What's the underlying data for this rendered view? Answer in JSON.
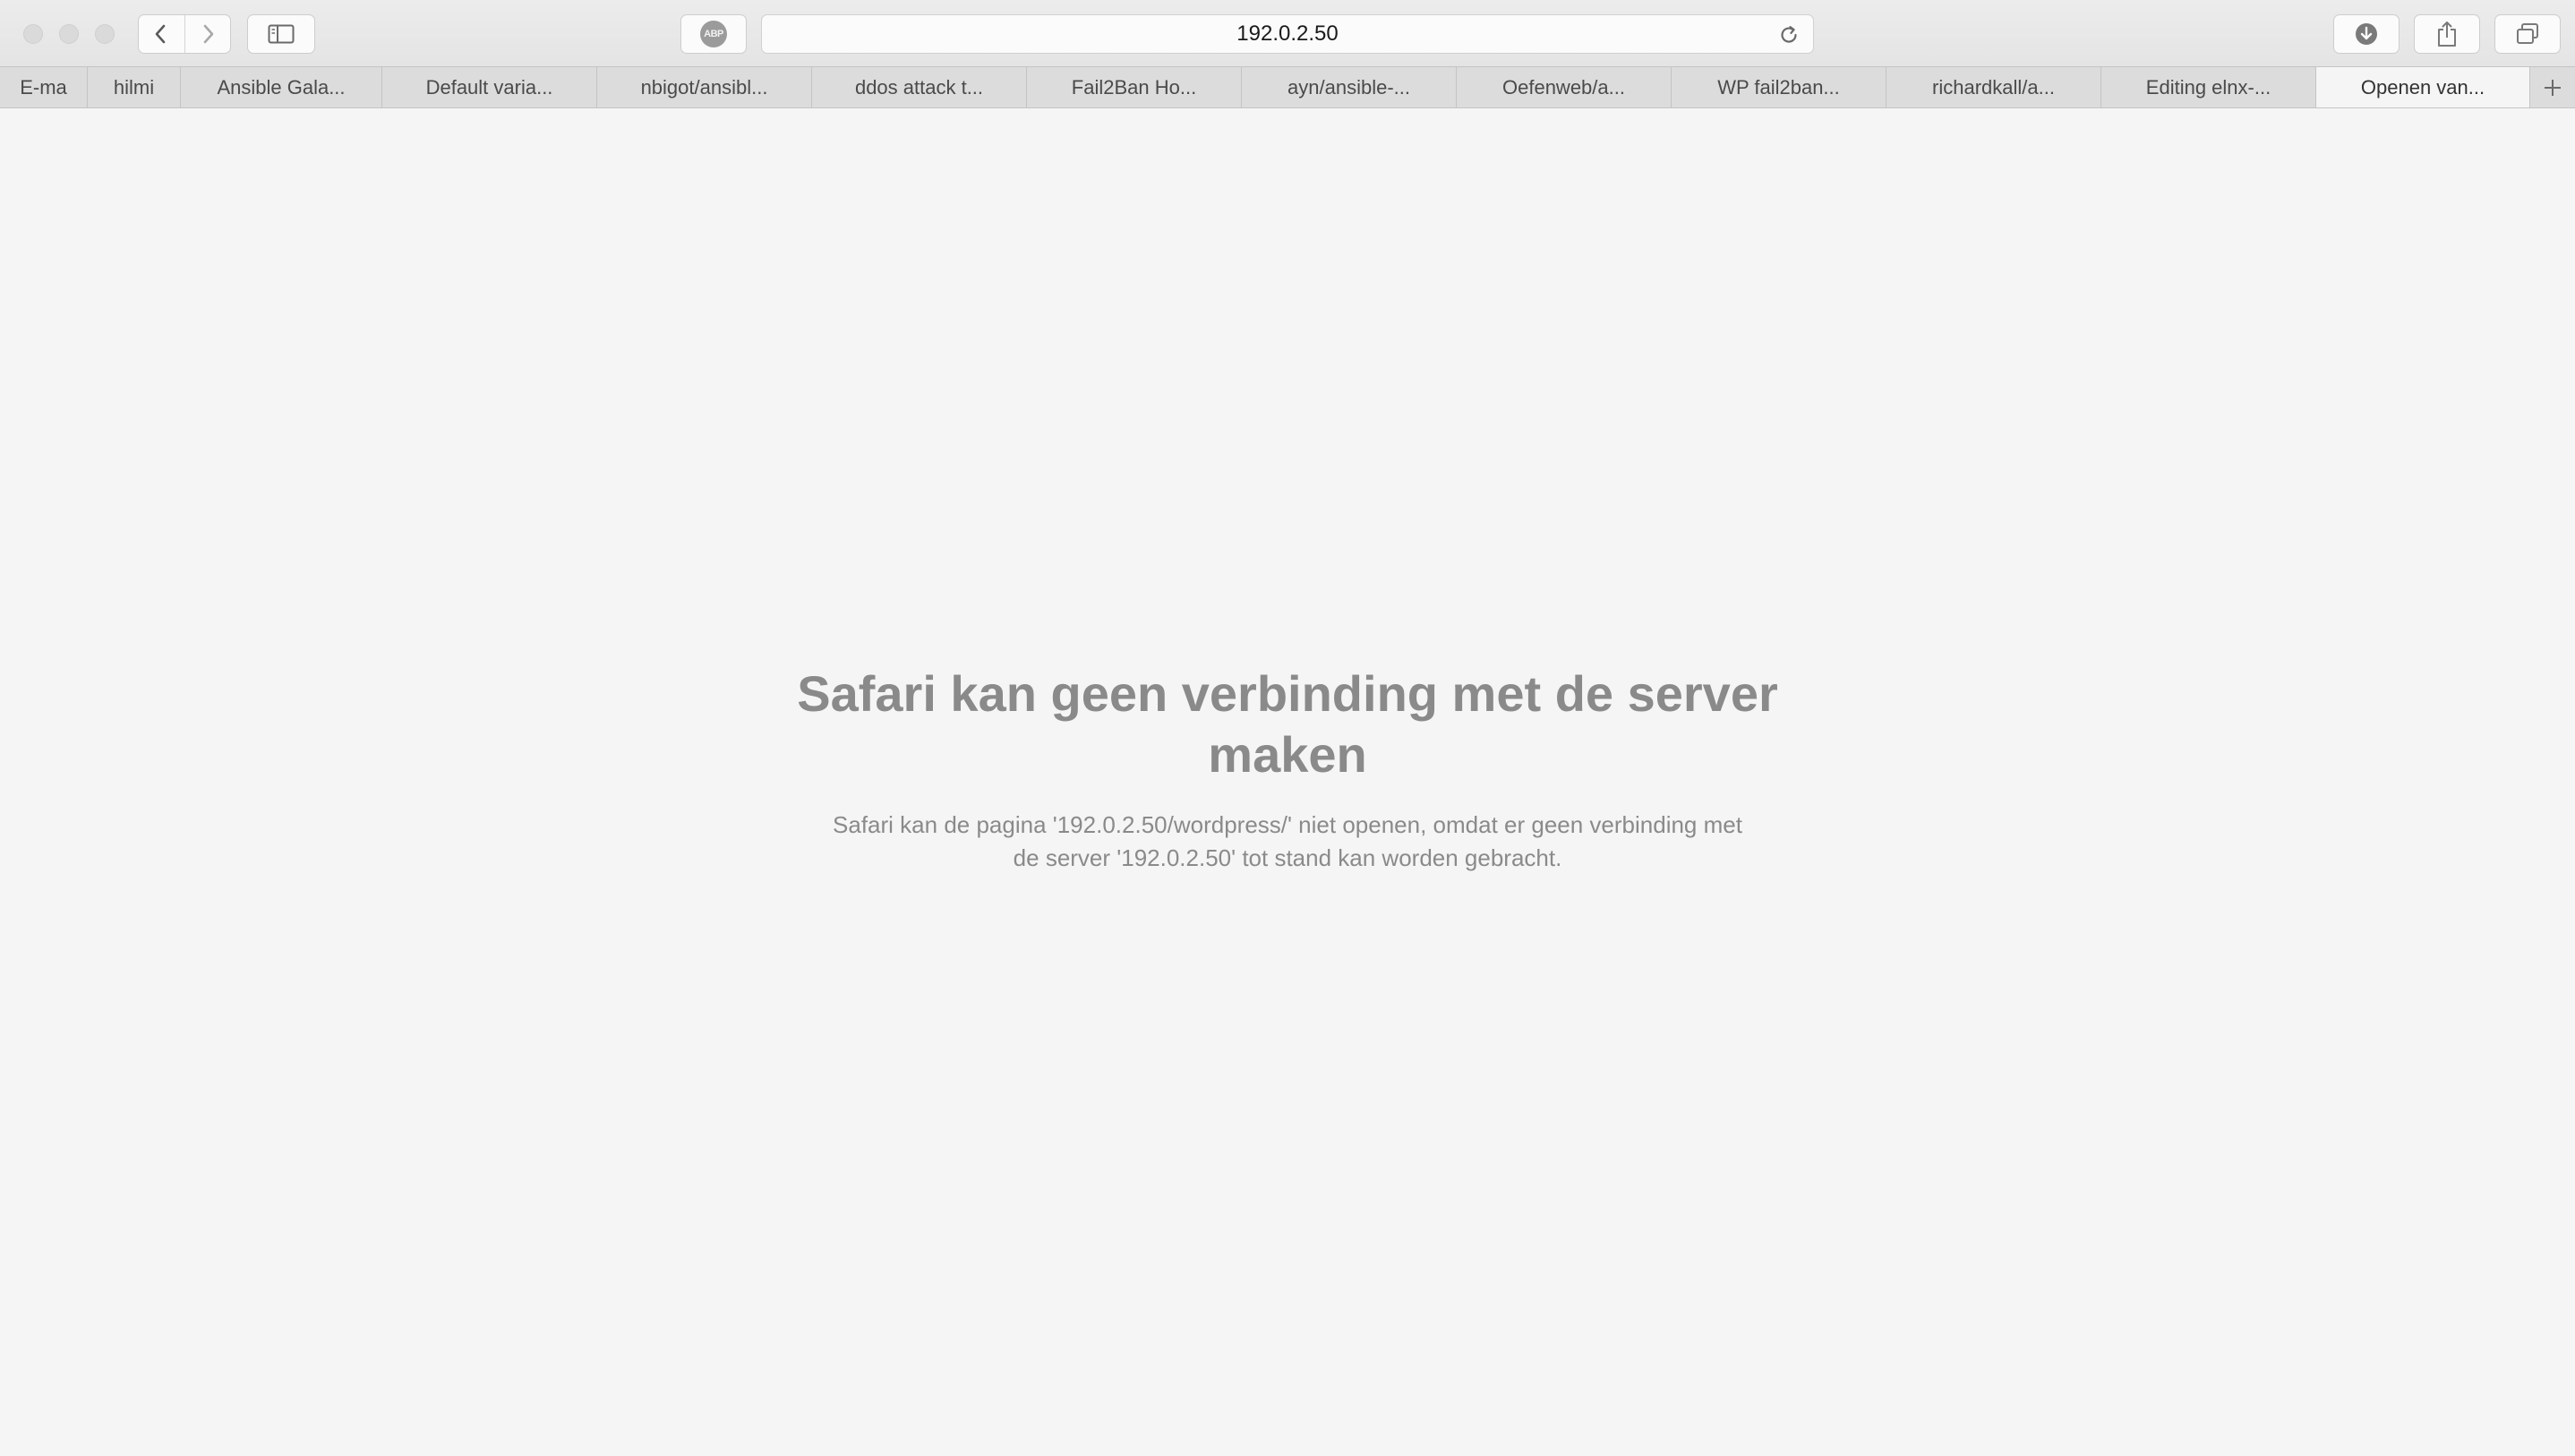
{
  "browser": {
    "address": "192.0.2.50",
    "abp_label": "ABP"
  },
  "tabs": [
    {
      "label": "E-ma"
    },
    {
      "label": "hilmi"
    },
    {
      "label": "Ansible Gala..."
    },
    {
      "label": "Default varia..."
    },
    {
      "label": "nbigot/ansibl..."
    },
    {
      "label": "ddos attack t..."
    },
    {
      "label": "Fail2Ban Ho..."
    },
    {
      "label": "ayn/ansible-..."
    },
    {
      "label": "Oefenweb/a..."
    },
    {
      "label": "WP fail2ban..."
    },
    {
      "label": "richardkall/a..."
    },
    {
      "label": "Editing elnx-..."
    },
    {
      "label": "Openen van..."
    }
  ],
  "error": {
    "title": "Safari kan geen verbinding met de server maken",
    "message": "Safari kan de pagina '192.0.2.50/wordpress/' niet openen, omdat er geen verbinding met de server '192.0.2.50' tot stand kan worden gebracht."
  },
  "icons": {
    "back": "chevron-left-icon",
    "forward": "chevron-right-icon",
    "sidebar": "sidebar-icon",
    "reload": "reload-icon",
    "downloads": "download-icon",
    "share": "share-icon",
    "tabs_overview": "tabs-overview-icon",
    "new_tab": "plus-icon"
  }
}
